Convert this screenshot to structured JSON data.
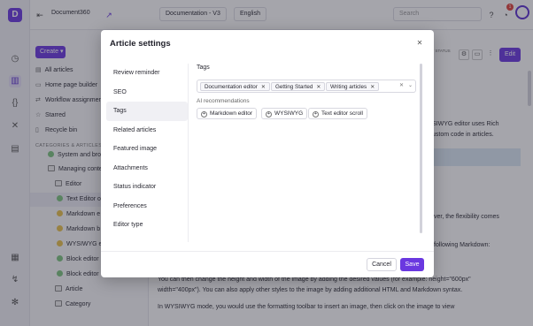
{
  "app": {
    "project_name": "Document360",
    "version_select": "Documentation - V3",
    "language_select": "English",
    "search_placeholder": "Search",
    "notification_count": "1"
  },
  "sidebar": {
    "create_label": "Create",
    "items": [
      {
        "label": "All articles",
        "icon": "articles-icon"
      },
      {
        "label": "Home page builder",
        "icon": "home-icon"
      },
      {
        "label": "Workflow assignmen",
        "icon": "workflow-icon"
      },
      {
        "label": "Starred",
        "icon": "star-icon"
      },
      {
        "label": "Recycle bin",
        "icon": "trash-icon"
      }
    ],
    "categories_label": "CATEGORIES & ARTICLES",
    "tree": [
      {
        "label": "System and bro",
        "kind": "article",
        "status": "green"
      },
      {
        "label": "Managing conte",
        "kind": "category"
      },
      {
        "label": "Editor",
        "kind": "category"
      },
      {
        "label": "Text Editor o",
        "kind": "article",
        "status": "green",
        "selected": true
      },
      {
        "label": "Markdown e",
        "kind": "article",
        "status": "yellow"
      },
      {
        "label": "Markdown b",
        "kind": "article",
        "status": "yellow"
      },
      {
        "label": "WYSIWYG e",
        "kind": "article",
        "status": "yellow"
      },
      {
        "label": "Block editor",
        "kind": "article",
        "status": "green"
      },
      {
        "label": "Block editor",
        "kind": "article",
        "status": "green"
      },
      {
        "label": "Article",
        "kind": "category"
      },
      {
        "label": "Category",
        "kind": "category"
      }
    ]
  },
  "content": {
    "status_label": "W STATUS",
    "status_value": "d",
    "edit_label": "Edit",
    "lines": [
      "SIWYG editor uses Rich",
      "ustom code in articles.",
      "ver, the flexibility comes",
      "following Markdown:",
      "You can then change the height and width of the image by adding the desired values (for example: height=\"600px\"",
      "width=\"400px\"). You can also apply other styles to the image by adding additional HTML and Markdown syntax.",
      "In WYSIWYG mode, you would use the formatting toolbar to insert an image, then click on the image to view"
    ]
  },
  "modal": {
    "title": "Article settings",
    "nav": [
      "Review reminder",
      "SEO",
      "Tags",
      "Related articles",
      "Featured image",
      "Attachments",
      "Status indicator",
      "Preferences",
      "Editor type"
    ],
    "active_nav": "Tags",
    "tags_heading": "Tags",
    "selected_tags": [
      "Documentation editor",
      "Getting Started",
      "Writing articles"
    ],
    "ai_label": "AI recommendations",
    "recommendations": [
      "Markdown editor",
      "WYSIWYG",
      "Text editor scroll"
    ],
    "cancel_label": "Cancel",
    "save_label": "Save"
  },
  "colors": {
    "accent": "#6a38e0",
    "status_green": "#7cc47f",
    "status_yellow": "#e8c14a",
    "overlay": "rgba(40,40,55,0.42)"
  }
}
